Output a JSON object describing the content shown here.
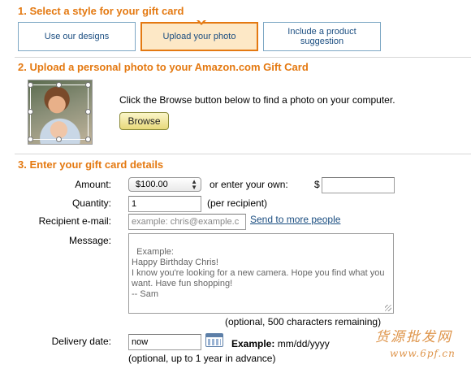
{
  "sections": {
    "style_title": "1. Select a style for your gift card",
    "upload_title": "2. Upload a personal photo to your Amazon.com Gift Card",
    "details_title": "3. Enter your gift card details"
  },
  "tabs": [
    {
      "label": "Use our designs",
      "selected": false
    },
    {
      "label": "Upload your photo",
      "selected": true
    },
    {
      "label": "Include a product suggestion",
      "selected": false
    }
  ],
  "upload": {
    "instruction": "Click the Browse button below to find a photo on your computer.",
    "browse_label": "Browse"
  },
  "details": {
    "amount_label": "Amount:",
    "amount_value": "$100.00",
    "or_enter_label": "or enter your own:",
    "currency_symbol": "$",
    "own_amount_value": "",
    "quantity_label": "Quantity:",
    "quantity_value": "1",
    "per_recipient": "(per recipient)",
    "recipient_label": "Recipient e-mail:",
    "recipient_placeholder": "example: chris@example.c",
    "send_more_link": "Send to more people",
    "message_label": "Message:",
    "message_placeholder": "Example:\nHappy Birthday Chris!\nI know you're looking for a new camera. Hope you find what you want. Have fun shopping!\n-- Sam",
    "message_note": "(optional, 500 characters remaining)",
    "delivery_label": "Delivery date:",
    "delivery_value": "now",
    "example_bold": "Example:",
    "example_format": "mm/dd/yyyy",
    "delivery_note": "(optional, up to 1 year in advance)"
  },
  "watermark": {
    "line1": "货源批发网",
    "line2": "www.6pf.cn"
  },
  "colors": {
    "accent": "#e47911",
    "link": "#1a4d80"
  }
}
